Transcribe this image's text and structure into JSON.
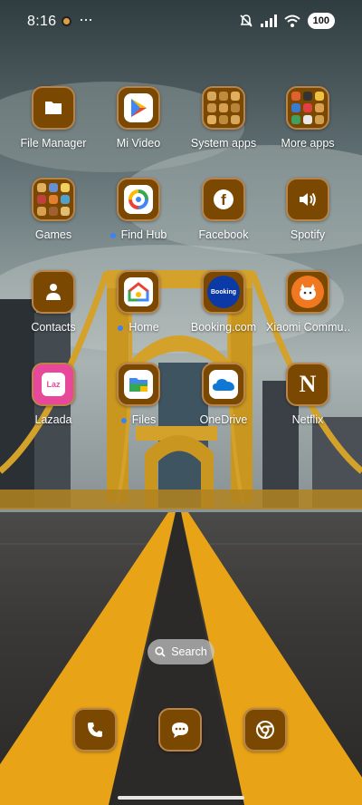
{
  "status_bar": {
    "time": "8:16",
    "more": "···",
    "battery": "100"
  },
  "apps": [
    {
      "label": "File Manager",
      "icon": "folder-icon",
      "badge": false
    },
    {
      "label": "Mi Video",
      "icon": "play-icon",
      "badge": false
    },
    {
      "label": "System apps",
      "icon": "folder-grid-icon",
      "badge": false
    },
    {
      "label": "More apps",
      "icon": "folder-grid-icon",
      "badge": false
    },
    {
      "label": "Games",
      "icon": "folder-grid-icon",
      "badge": false
    },
    {
      "label": "Find Hub",
      "icon": "find-hub-icon",
      "badge": true
    },
    {
      "label": "Facebook",
      "icon": "facebook-icon",
      "badge": false
    },
    {
      "label": "Spotify",
      "icon": "speaker-icon",
      "badge": false
    },
    {
      "label": "Contacts",
      "icon": "person-icon",
      "badge": false
    },
    {
      "label": "Home",
      "icon": "google-home-icon",
      "badge": true
    },
    {
      "label": "Booking.com",
      "icon": "booking-icon",
      "badge": false
    },
    {
      "label": "Xiaomi Commu…",
      "icon": "xiaomi-community-icon",
      "badge": false
    },
    {
      "label": "Lazada",
      "icon": "lazada-icon",
      "badge": false
    },
    {
      "label": "Files",
      "icon": "files-icon",
      "badge": true
    },
    {
      "label": "OneDrive",
      "icon": "onedrive-icon",
      "badge": false
    },
    {
      "label": "Netflix",
      "icon": "netflix-icon",
      "badge": false
    }
  ],
  "icon_text": {
    "booking": "Booking",
    "netflix": "N",
    "lazada": "Laz"
  },
  "search": {
    "label": "Search"
  },
  "dock": [
    {
      "name": "phone-icon"
    },
    {
      "name": "messages-icon"
    },
    {
      "name": "chrome-icon"
    }
  ],
  "colors": {
    "icon_bg": "#7a4800",
    "icon_border": "#b8844a",
    "badge_dot": "#3b82f6",
    "road_line": "#e8a317"
  }
}
